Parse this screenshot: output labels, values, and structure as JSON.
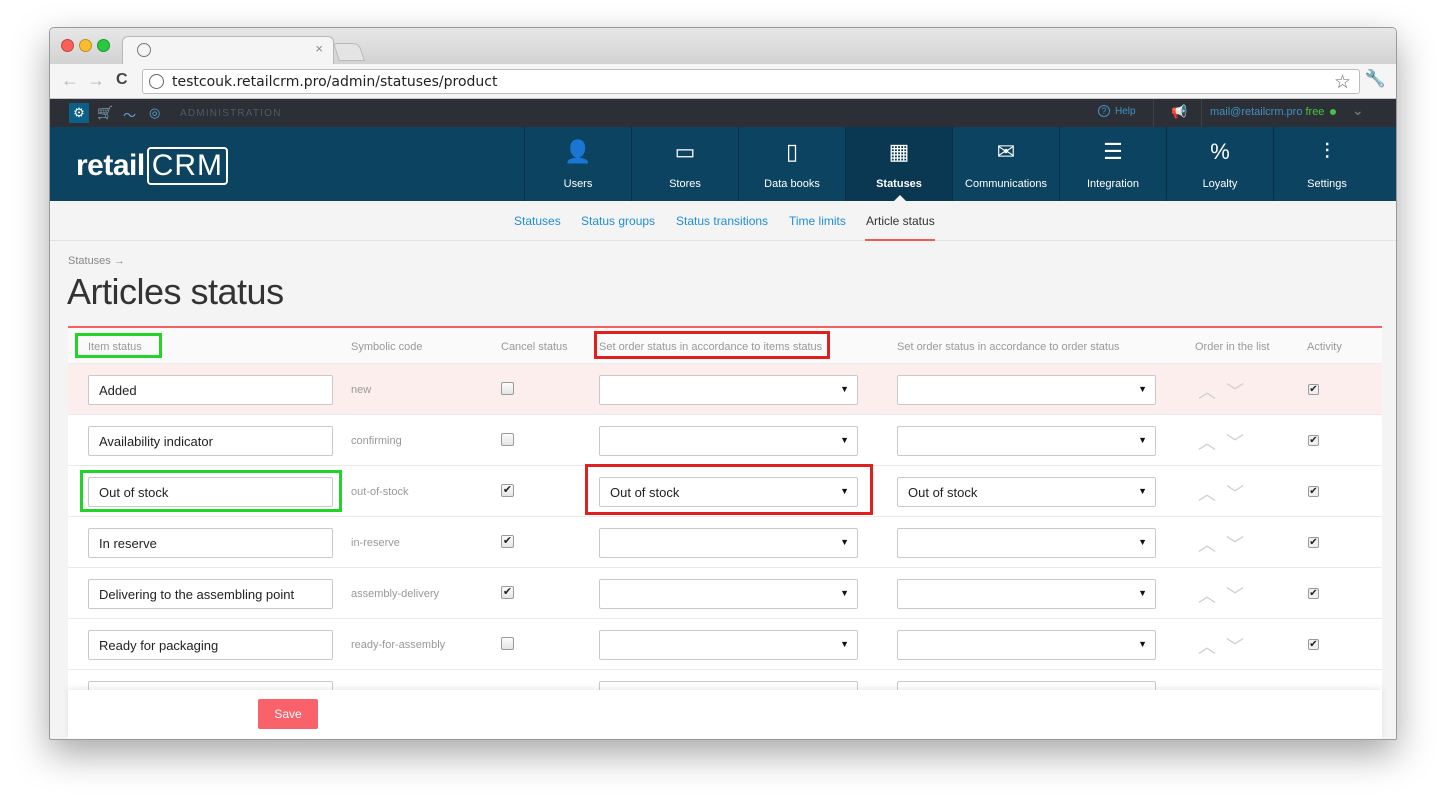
{
  "browser": {
    "url": "testcouk.retailcrm.pro/admin/statuses/product",
    "tab_close": "×",
    "back": "←",
    "forward": "→",
    "reload": "C",
    "star": "☆",
    "wrench": "🔧"
  },
  "adminbar": {
    "label": "ADMINISTRATION",
    "help": "Help",
    "account_email": "mail@retailcrm.pro",
    "plan": "free"
  },
  "logo": {
    "retail": "retail",
    "crm": "CRM"
  },
  "nav": {
    "items": [
      {
        "label": "Users",
        "icon": "👤"
      },
      {
        "label": "Stores",
        "icon": "▭"
      },
      {
        "label": "Data books",
        "icon": "▯"
      },
      {
        "label": "Statuses",
        "icon": "▦"
      },
      {
        "label": "Communications",
        "icon": "✉"
      },
      {
        "label": "Integration",
        "icon": "☰"
      },
      {
        "label": "Loyalty",
        "icon": "%"
      },
      {
        "label": "Settings",
        "icon": "⫶"
      }
    ]
  },
  "subnav": {
    "items": [
      "Statuses",
      "Status groups",
      "Status transitions",
      "Time limits",
      "Article status"
    ]
  },
  "breadcrumb": "Statuses →",
  "page_title": "Articles status",
  "table": {
    "headers": {
      "item_status": "Item status",
      "symbolic_code": "Symbolic code",
      "cancel_status": "Cancel status",
      "items_status": "Set order status in accordance to items status",
      "order_status": "Set order status in accordance to order status",
      "order_list": "Order in the list",
      "activity": "Activity"
    },
    "rows": [
      {
        "name": "Added",
        "code": "new",
        "cancel": "",
        "by_items": "",
        "by_order": "",
        "active": "✔"
      },
      {
        "name": "Availability indicator",
        "code": "confirming",
        "cancel": "",
        "by_items": "",
        "by_order": "",
        "active": "✔"
      },
      {
        "name": "Out of stock",
        "code": "out-of-stock",
        "cancel": "✔",
        "by_items": "Out of stock",
        "by_order": "Out of stock",
        "active": "✔"
      },
      {
        "name": "In reserve",
        "code": "in-reserve",
        "cancel": "✔",
        "by_items": "",
        "by_order": "",
        "active": "✔"
      },
      {
        "name": "Delivering to the assembling point",
        "code": "assembly-delivery",
        "cancel": "✔",
        "by_items": "",
        "by_order": "",
        "active": "✔"
      },
      {
        "name": "Ready for packaging",
        "code": "ready-for-assembly",
        "cancel": "",
        "by_items": "",
        "by_order": "",
        "active": "✔"
      }
    ],
    "caret": "▼",
    "reorder_arrows": "︿﹀"
  },
  "footer": {
    "save_label": "Save"
  },
  "colors": {
    "header_bg": "#0c4361",
    "accent_red": "#f9626b",
    "highlight_green": "#22d32a",
    "highlight_red": "#e01f1f",
    "link_blue": "#1f8ed5"
  }
}
